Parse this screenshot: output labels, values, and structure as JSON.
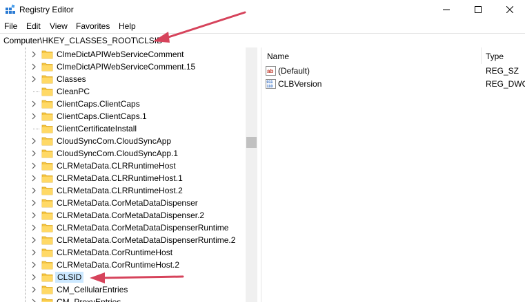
{
  "window": {
    "title": "Registry Editor"
  },
  "menu": [
    "File",
    "Edit",
    "View",
    "Favorites",
    "Help"
  ],
  "address": "Computer\\HKEY_CLASSES_ROOT\\CLSID",
  "tree": {
    "items": [
      {
        "label": "ClmeDictAPIWebServiceComment",
        "expandable": true
      },
      {
        "label": "ClmeDictAPIWebServiceComment.15",
        "expandable": true
      },
      {
        "label": "Classes",
        "expandable": true
      },
      {
        "label": "CleanPC",
        "expandable": false
      },
      {
        "label": "ClientCaps.ClientCaps",
        "expandable": true
      },
      {
        "label": "ClientCaps.ClientCaps.1",
        "expandable": true
      },
      {
        "label": "ClientCertificateInstall",
        "expandable": false
      },
      {
        "label": "CloudSyncCom.CloudSyncApp",
        "expandable": true
      },
      {
        "label": "CloudSyncCom.CloudSyncApp.1",
        "expandable": true
      },
      {
        "label": "CLRMetaData.CLRRuntimeHost",
        "expandable": true
      },
      {
        "label": "CLRMetaData.CLRRuntimeHost.1",
        "expandable": true
      },
      {
        "label": "CLRMetaData.CLRRuntimeHost.2",
        "expandable": true
      },
      {
        "label": "CLRMetaData.CorMetaDataDispenser",
        "expandable": true
      },
      {
        "label": "CLRMetaData.CorMetaDataDispenser.2",
        "expandable": true
      },
      {
        "label": "CLRMetaData.CorMetaDataDispenserRuntime",
        "expandable": true
      },
      {
        "label": "CLRMetaData.CorMetaDataDispenserRuntime.2",
        "expandable": true
      },
      {
        "label": "CLRMetaData.CorRuntimeHost",
        "expandable": true
      },
      {
        "label": "CLRMetaData.CorRuntimeHost.2",
        "expandable": true
      },
      {
        "label": "CLSID",
        "expandable": true,
        "selected": true
      },
      {
        "label": "CM_CellularEntries",
        "expandable": true
      },
      {
        "label": "CM_ProxyEntries",
        "expandable": true
      }
    ]
  },
  "list": {
    "headers": {
      "name": "Name",
      "type": "Type"
    },
    "rows": [
      {
        "name": "(Default)",
        "type": "REG_SZ",
        "icon": "string-value-icon"
      },
      {
        "name": "CLBVersion",
        "type": "REG_DWOR",
        "icon": "dword-value-icon"
      }
    ]
  },
  "colors": {
    "annotation": "#d6435b",
    "folder": "#f5c542",
    "selection": "#cce8ff"
  }
}
